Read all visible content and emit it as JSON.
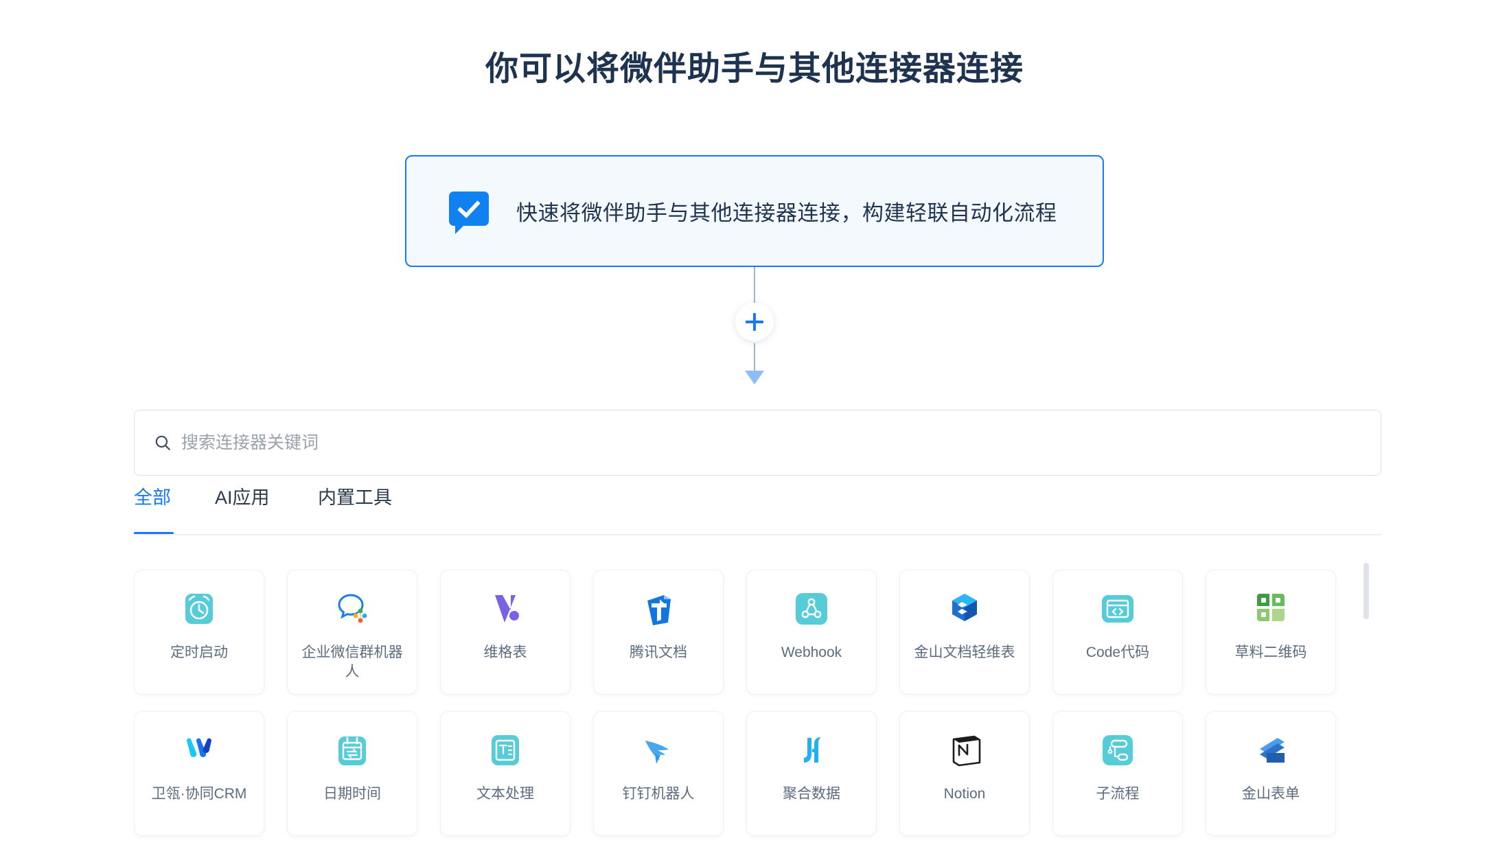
{
  "header": {
    "title": "你可以将微伴助手与其他连接器连接"
  },
  "trigger_card": {
    "icon": "checkmark-bubble-icon",
    "text": "快速将微伴助手与其他连接器连接，构建轻联自动化流程",
    "border_color": "#1677ff",
    "background_color": "#f4f9fe"
  },
  "connector": {
    "add_node_icon": "plus-icon",
    "line_color": "#9fb6c8",
    "arrow_color": "#8fbcf5",
    "accent_color": "#1677ff"
  },
  "search": {
    "icon": "search-icon",
    "value": "",
    "placeholder": "搜索连接器关键词"
  },
  "tabs": {
    "active_index": 0,
    "items": [
      {
        "label": "全部"
      },
      {
        "label": "AI应用"
      },
      {
        "label": "内置工具"
      }
    ]
  },
  "connectors": [
    {
      "label": "定时启动",
      "icon": "alarm-clock-icon",
      "color": "#56ccd8"
    },
    {
      "label": "企业微信群机器人",
      "icon": "wecom-group-bot-icon",
      "color": "#1a7de8"
    },
    {
      "label": "维格表",
      "icon": "vika-icon",
      "color": "#7b61e4"
    },
    {
      "label": "腾讯文档",
      "icon": "tencent-docs-icon",
      "color": "#1076e0"
    },
    {
      "label": "Webhook",
      "icon": "webhook-icon",
      "color": "#56ccd8"
    },
    {
      "label": "金山文档轻维表",
      "icon": "kingsoft-sheet-icon",
      "color": "#1f6fd0"
    },
    {
      "label": "Code代码",
      "icon": "code-icon",
      "color": "#56ccd8"
    },
    {
      "label": "草料二维码",
      "icon": "cli-qrcode-icon",
      "color": "#3f9c42"
    },
    {
      "label": "卫瓴·协同CRM",
      "icon": "weiling-crm-icon",
      "color": "#1a73f0"
    },
    {
      "label": "日期时间",
      "icon": "calendar-swap-icon",
      "color": "#56ccd8"
    },
    {
      "label": "文本处理",
      "icon": "text-document-icon",
      "color": "#56ccd8"
    },
    {
      "label": "钉钉机器人",
      "icon": "dingtalk-robot-icon",
      "color": "#4aa8ea"
    },
    {
      "label": "聚合数据",
      "icon": "juhe-data-icon",
      "color": "#22b0f3"
    },
    {
      "label": "Notion",
      "icon": "notion-icon",
      "color": "#1c1c1c"
    },
    {
      "label": "子流程",
      "icon": "subflow-icon",
      "color": "#56ccd8"
    },
    {
      "label": "金山表单",
      "icon": "kingsoft-form-icon",
      "color": "#2f73c8"
    }
  ],
  "scrollbar": {
    "thumb_color": "#dfe2e6"
  }
}
